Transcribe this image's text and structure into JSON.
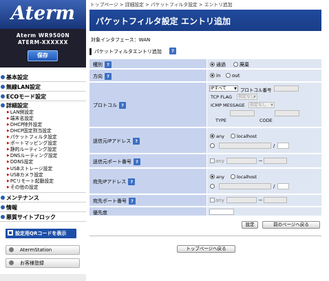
{
  "sidebar": {
    "logo": "Aterm",
    "model_name": "Aterm WR9500N",
    "model_id": "ATERM-XXXXXX",
    "save_label": "保存",
    "nav": [
      {
        "label": "基本設定",
        "type": "main"
      },
      {
        "label": "無線LAN設定",
        "type": "main"
      },
      {
        "label": "ECOモード設定",
        "type": "main"
      },
      {
        "label": "詳細設定",
        "type": "main"
      },
      {
        "label": "LAN側設定",
        "type": "sub"
      },
      {
        "label": "端末名設定",
        "type": "sub"
      },
      {
        "label": "DHCP除外設定",
        "type": "sub"
      },
      {
        "label": "DHCP固定割当設定",
        "type": "sub"
      },
      {
        "label": "パケットフィルタ設定",
        "type": "sub"
      },
      {
        "label": "ポートマッピング設定",
        "type": "sub"
      },
      {
        "label": "静的ルーティング設定",
        "type": "sub"
      },
      {
        "label": "DNSルーティング設定",
        "type": "sub"
      },
      {
        "label": "DDNS設定",
        "type": "sub"
      },
      {
        "label": "USBストレージ設定",
        "type": "sub"
      },
      {
        "label": "USBカメラ設定",
        "type": "sub"
      },
      {
        "label": "PCリモート起動設定",
        "type": "sub"
      },
      {
        "label": "その他の設定",
        "type": "sub"
      },
      {
        "label": "メンテナンス",
        "type": "main"
      },
      {
        "label": "情報",
        "type": "main"
      },
      {
        "label": "悪質サイトブロック",
        "type": "main"
      }
    ],
    "qr_label": "設定用QRコードを表示",
    "aterm_station_label": "AtermStation",
    "customer_reg_label": "お客様登録"
  },
  "main": {
    "breadcrumb": "トップページ > 詳細設定 > パケットフィルタ設定 > エントリ追加",
    "title": "パケットフィルタ設定 エントリ追加",
    "interface_line": "対象インタフェース：WAN",
    "section_title": "パケットフィルタエントリ追加",
    "help_icon": "?",
    "rows": {
      "type": {
        "label": "種別",
        "opt1": "通過",
        "opt2": "廃棄"
      },
      "direction": {
        "label": "方向",
        "opt1": "in",
        "opt2": "out"
      },
      "protocol": {
        "label": "プロトコル",
        "select": "IPすべて",
        "proto_num_label": "プロトコル番号",
        "tcp_flag_label": "TCP FLAG",
        "tcp_flag_select": "指定なし",
        "icmp_label": "ICMP MESSAGE",
        "icmp_select": "指定なし",
        "type_label": "TYPE",
        "code_label": "CODE"
      },
      "src_ip": {
        "label": "送信元IPアドレス",
        "opt1": "any",
        "opt2": "localhost",
        "slash": "/"
      },
      "src_port": {
        "label": "送信元ポート番号",
        "any": "any",
        "dash": "－"
      },
      "dst_ip": {
        "label": "宛先IPアドレス",
        "opt1": "any",
        "opt2": "localhost",
        "slash": "/"
      },
      "dst_port": {
        "label": "宛先ポート番号",
        "any": "any",
        "dash": "－"
      },
      "priority": {
        "label": "優先度"
      }
    },
    "set_button": "設定",
    "back_button": "前のページへ戻る",
    "top_button": "トップページへ戻る"
  },
  "colors": {
    "title_bar": "#1f4a9c",
    "label_cell": "#c7d3ee",
    "value_cell": "#dfe6f3",
    "accent_blue": "#2a5cb0",
    "qr_button": "#1d4fa8"
  }
}
